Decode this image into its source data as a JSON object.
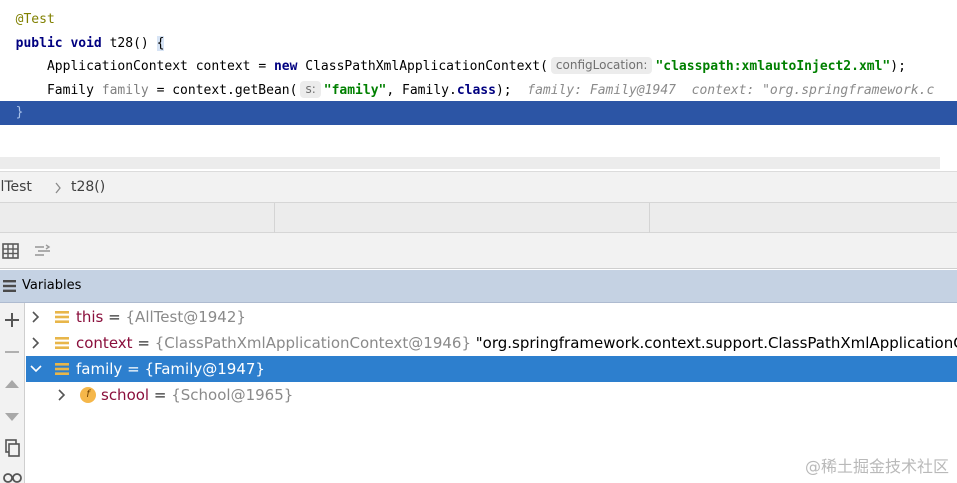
{
  "editor": {
    "annotation": "@Test",
    "sig_kw1": "public",
    "sig_kw2": "void",
    "sig_method": "t28()",
    "sig_brace": "{",
    "l3_type": "ApplicationContext",
    "l3_var": "context",
    "l3_eq": "=",
    "l3_new": "new",
    "l3_ctor": "ClassPathXmlApplicationContext(",
    "l3_hint": "configLocation:",
    "l3_string": "\"classpath:xmlautoInject2.xml\"",
    "l3_end": ");",
    "l4_type": "Family",
    "l4_var": "family",
    "l4_mid": "= context.getBean(",
    "l4_hint": "s:",
    "l4_string": "\"family\"",
    "l4_comma": ", Family.",
    "l4_class_kw": "class",
    "l4_end": ");",
    "l4_inline1": "family: Family@1947",
    "l4_inline2": "context: \"org.springframework.c",
    "l5_brace": "}"
  },
  "breadcrumb": {
    "class_name": "AllTest",
    "method": "t28()"
  },
  "variables": {
    "title": "Variables",
    "rows": [
      {
        "name": "this",
        "eq": "=",
        "type": "{AllTest@1942}",
        "value": ""
      },
      {
        "name": "context",
        "eq": "=",
        "type": "{ClassPathXmlApplicationContext@1946}",
        "value": "\"org.springframework.context.support.ClassPathXmlApplicationContext"
      },
      {
        "name": "family",
        "eq": "=",
        "type": "{Family@1947}",
        "value": ""
      },
      {
        "name": "school",
        "eq": "=",
        "type": "{School@1965}",
        "value": "",
        "field_badge": "f"
      }
    ]
  },
  "watermark": "@稀土掘金技术社区",
  "colors": {
    "selection": "#2d7fce",
    "editor_caret_line": "#2c55a5",
    "vars_header": "#c5d2e3"
  }
}
